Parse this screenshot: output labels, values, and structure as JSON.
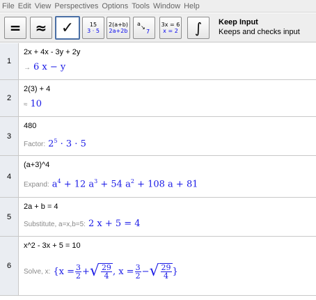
{
  "menu": [
    "File",
    "Edit",
    "View",
    "Perspectives",
    "Options",
    "Tools",
    "Window",
    "Help"
  ],
  "toolbar": {
    "tool_title": "Keep Input",
    "tool_desc": "Keeps and checks input",
    "eval_symbol": "=",
    "numeric_symbol": "≈",
    "check_symbol": "✓",
    "factor_top": "15",
    "factor_bottom": "3 · 5",
    "expand_top": "2(a+b)",
    "expand_bottom": "2a+2b",
    "subst_a": "a",
    "subst_b": "7",
    "solve_top": "3x = 6",
    "solve_bottom": "x = 2",
    "integral_symbol": "∫"
  },
  "rows": [
    {
      "num": "1",
      "input": "2x + 4x - 3y + 2y",
      "cmd": "→",
      "res": "6 x − y"
    },
    {
      "num": "2",
      "input": "2(3) + 4",
      "cmd": "≈",
      "res": "10"
    },
    {
      "num": "3",
      "input": "480",
      "cmd": "Factor:",
      "res_a": "2",
      "res_a_exp": "5",
      "res_b": " · 3 · 5"
    },
    {
      "num": "4",
      "input": "(a+3)^4",
      "cmd": "Expand:",
      "t1": "a",
      "e1": "4",
      "t2": " + 12 a",
      "e2": "3",
      "t3": " + 54 a",
      "e3": "2",
      "t4": " + 108 a + 81"
    },
    {
      "num": "5",
      "input": "2a + b = 4",
      "cmd": "Substitute, a=x,b=5:",
      "res": "2 x + 5 = 4"
    },
    {
      "num": "6",
      "input": "x^2 - 3x + 5 = 10",
      "cmd": "Solve, x:",
      "open": "{x =",
      "f1n": "3",
      "f1d": "2",
      "plus": "+",
      "s1n": "29",
      "s1d": "4",
      "sep": ", x =",
      "f2n": "3",
      "f2d": "2",
      "minus": "−",
      "s2n": "29",
      "s2d": "4",
      "close": "}"
    }
  ],
  "colors": {
    "result": "#1a1ae6",
    "command": "#888888",
    "row_header": "#eaedf2"
  }
}
